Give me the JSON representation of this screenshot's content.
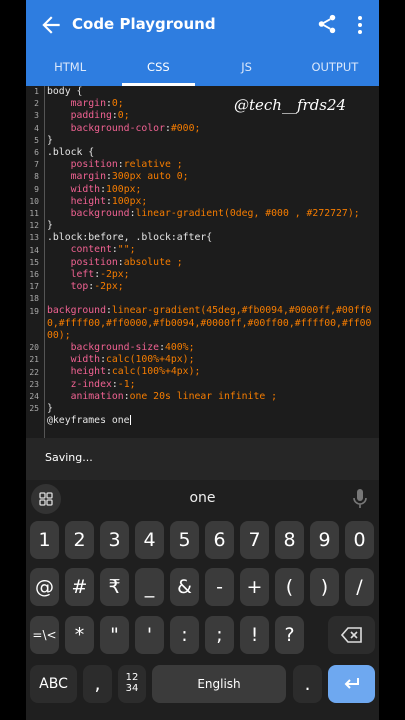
{
  "appbar": {
    "title": "Code Playground"
  },
  "tabs": [
    {
      "label": "HTML",
      "active": false
    },
    {
      "label": "CSS",
      "active": true
    },
    {
      "label": "JS",
      "active": false
    },
    {
      "label": "OUTPUT",
      "active": false
    }
  ],
  "watermark": "@tech__frds24",
  "editor": {
    "line_numbers": [
      "1",
      "2",
      "3",
      "4",
      "5",
      "6",
      "7",
      "8",
      "9",
      "10",
      "11",
      "12",
      "13",
      "14",
      "15",
      "16",
      "17",
      "18",
      "19",
      "20",
      "21",
      "22",
      "23",
      "24",
      "25"
    ],
    "code": [
      "body {",
      "    margin:0;",
      "    padding:0;",
      "    background-color:#000;",
      "}",
      ".block {",
      "    position:relative ;",
      "    margin:300px auto 0;",
      "    width:100px;",
      "    height:100px;",
      "    background:linear-gradient(0deg, #000 , #272727);",
      "}",
      ".block:before, .block:after{",
      "    content:\"\";",
      "    position:absolute ;",
      "    left:-2px;",
      "    top:-2px;",
      "",
      "background:linear-gradient(45deg,#fb0094,#0000ff,#00ff0",
      "0,#ffff00,#ff0000,#fb0094,#0000ff,#00ff00,#ffff00,#ff00",
      "00);",
      "    background-size:400%;",
      "    width:calc(100%+4px);",
      "    height:calc(100%+4px);",
      "    z-index:-1;",
      "    animation:one 20s linear infinite ;",
      "}",
      "@keyframes one"
    ]
  },
  "status": {
    "message": "Saving..."
  },
  "keyboard": {
    "suggestion": "one",
    "row_numbers": [
      "1",
      "2",
      "3",
      "4",
      "5",
      "6",
      "7",
      "8",
      "9",
      "0"
    ],
    "row_symbols1": [
      "@",
      "#",
      "₹",
      "_",
      "&",
      "-",
      "+",
      "(",
      ")",
      "/"
    ],
    "row_symbols2": [
      "=\\<",
      "*",
      "\"",
      "'",
      ":",
      ";",
      "!",
      "?"
    ],
    "bottom": {
      "abc": "ABC",
      "comma": ",",
      "numpad": "12\n34",
      "space": "English",
      "period": "."
    }
  },
  "colors": {
    "appbar": "#2e7de0",
    "property": "#f06292",
    "value": "#f57c00",
    "enter_key": "#6ea8f0"
  }
}
